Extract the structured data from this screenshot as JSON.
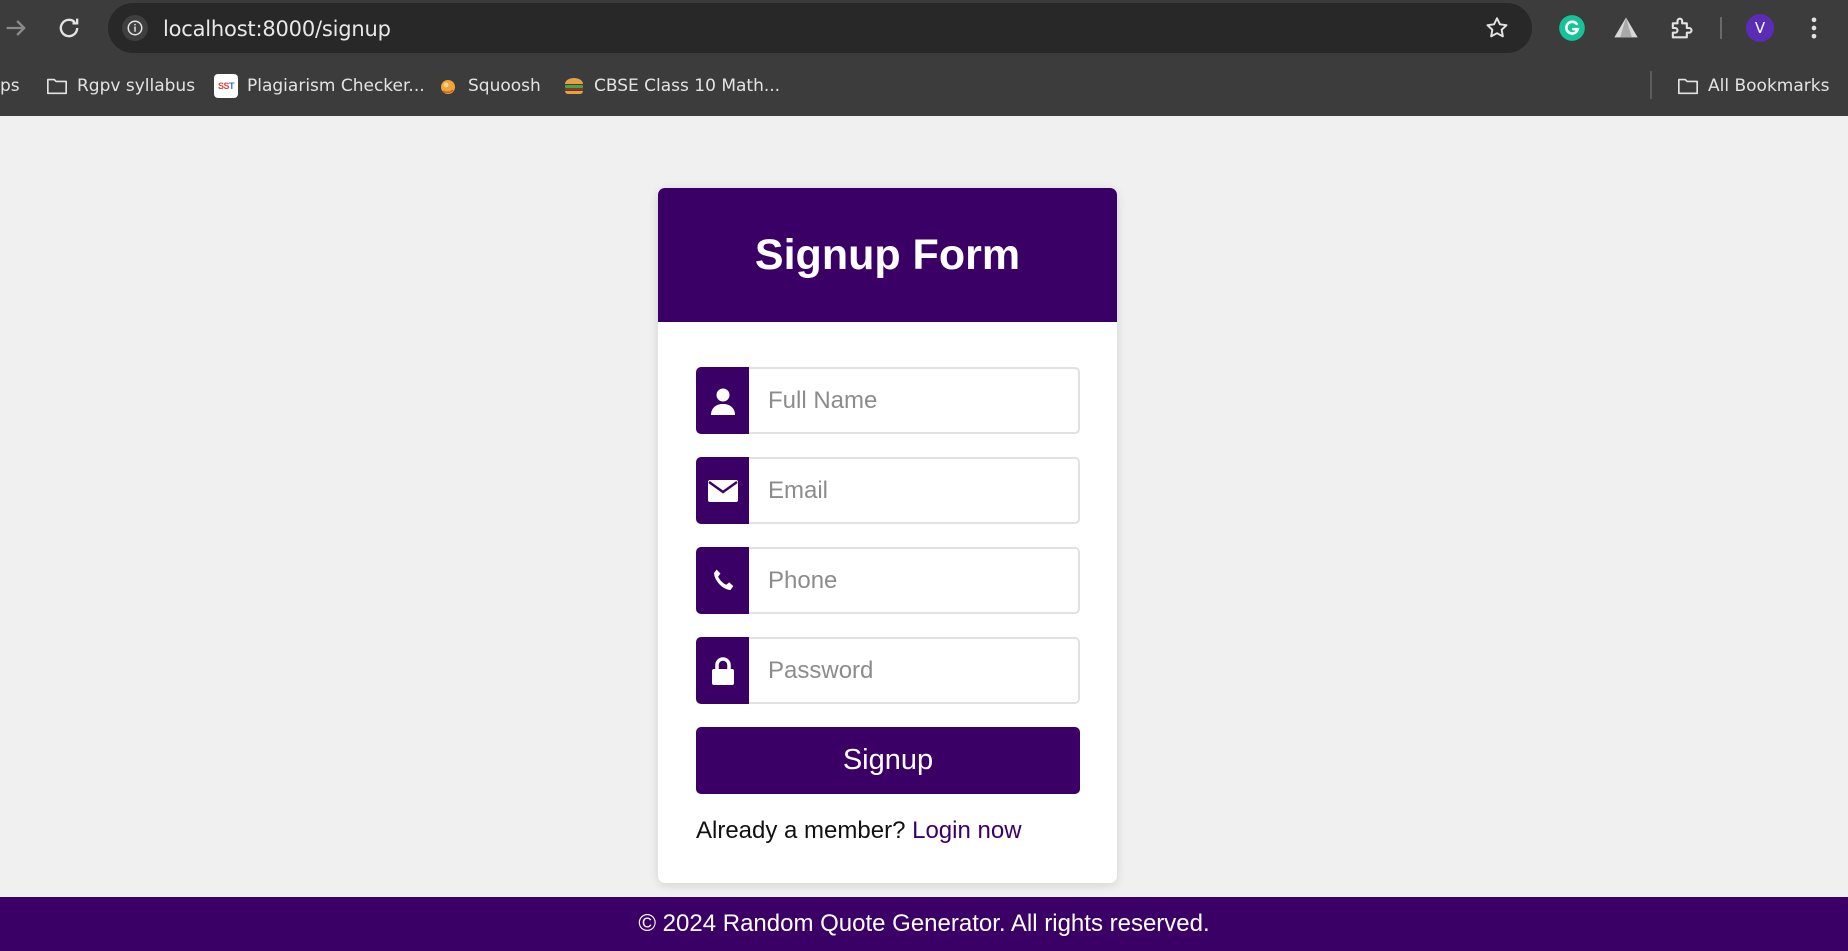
{
  "browser": {
    "url": "localhost:8000/signup",
    "avatar_letter": "V",
    "bookmarks": [
      {
        "label": "ps",
        "icon": "none"
      },
      {
        "label": "Rgpv syllabus",
        "icon": "folder-icon"
      },
      {
        "label": "Plagiarism Checker...",
        "icon": "sst-favicon"
      },
      {
        "label": "Squoosh",
        "icon": "squoosh-favicon"
      },
      {
        "label": "CBSE Class 10 Math...",
        "icon": "burger-favicon"
      }
    ],
    "all_bookmarks_label": "All Bookmarks",
    "sst_favicon_text_a": "SS",
    "sst_favicon_text_b": "T"
  },
  "signup": {
    "title": "Signup Form",
    "fields": [
      {
        "name": "full-name",
        "placeholder": "Full Name",
        "icon": "user-icon",
        "type": "text"
      },
      {
        "name": "email",
        "placeholder": "Email",
        "icon": "envelope-icon",
        "type": "email"
      },
      {
        "name": "phone",
        "placeholder": "Phone",
        "icon": "phone-icon",
        "type": "tel"
      },
      {
        "name": "password",
        "placeholder": "Password",
        "icon": "lock-icon",
        "type": "password"
      }
    ],
    "submit_label": "Signup",
    "member_text": "Already a member?",
    "login_link": "Login now"
  },
  "footer": {
    "text": "© 2024 Random Quote Generator. All rights reserved."
  },
  "colors": {
    "brand": "#3b0066",
    "page_bg": "#f0f0f0",
    "chrome_bg": "#3c3c3c",
    "omnibox_bg": "#282828"
  }
}
